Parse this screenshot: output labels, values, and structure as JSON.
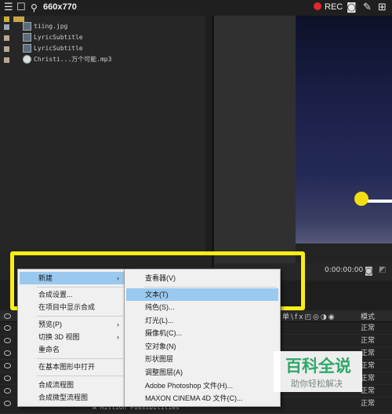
{
  "topbar": {
    "title": "660x770",
    "rec_label": "REC"
  },
  "project": {
    "items": [
      {
        "name": "tiing.jpg",
        "color": "#9aa7b6"
      },
      {
        "name": "LyricSubtitle",
        "color": "#b8a893"
      },
      {
        "name": "LyricSubtitle",
        "color": "#b8a893"
      },
      {
        "name": "Christi...万个可能.mp3",
        "color": "#b8a893"
      }
    ]
  },
  "viewer": {
    "timecode": "0:00:00:00"
  },
  "timeline": {
    "mode_header": "模式",
    "mode_values": [
      "正常",
      "正常",
      "正常",
      "正常",
      "正常",
      "正常",
      "正常"
    ],
    "bottom_layer": "A Million Possibilities"
  },
  "context_menu": {
    "items": [
      {
        "label": "新建",
        "submenu": true,
        "highlighted": true
      },
      {
        "label": "合成设置..."
      },
      {
        "label": "在项目中显示合成"
      },
      {
        "label": "预览(P)",
        "submenu": true
      },
      {
        "label": "切换 3D 视图",
        "submenu": true
      },
      {
        "label": "重命名"
      },
      {
        "label": "在基本图形中打开"
      },
      {
        "label": "合成流程图"
      },
      {
        "label": "合成微型流程图"
      }
    ]
  },
  "submenu": {
    "items": [
      {
        "label": "查看器(V)"
      },
      {
        "label": "文本(T)",
        "highlighted": true
      },
      {
        "label": "纯色(S)..."
      },
      {
        "label": "灯光(L)..."
      },
      {
        "label": "摄像机(C)..."
      },
      {
        "label": "空对象(N)"
      },
      {
        "label": "形状图层"
      },
      {
        "label": "调整图层(A)"
      },
      {
        "label": "Adobe Photoshop 文件(H)..."
      },
      {
        "label": "MAXON CINEMA 4D 文件(C)..."
      }
    ]
  },
  "watermark": {
    "title": "百科全说",
    "subtitle": "助你轻松解决"
  },
  "colors": {
    "highlight_box": "#f7ee16",
    "menu_highlight": "#99c9ef",
    "rec_dot": "#e0292a"
  }
}
